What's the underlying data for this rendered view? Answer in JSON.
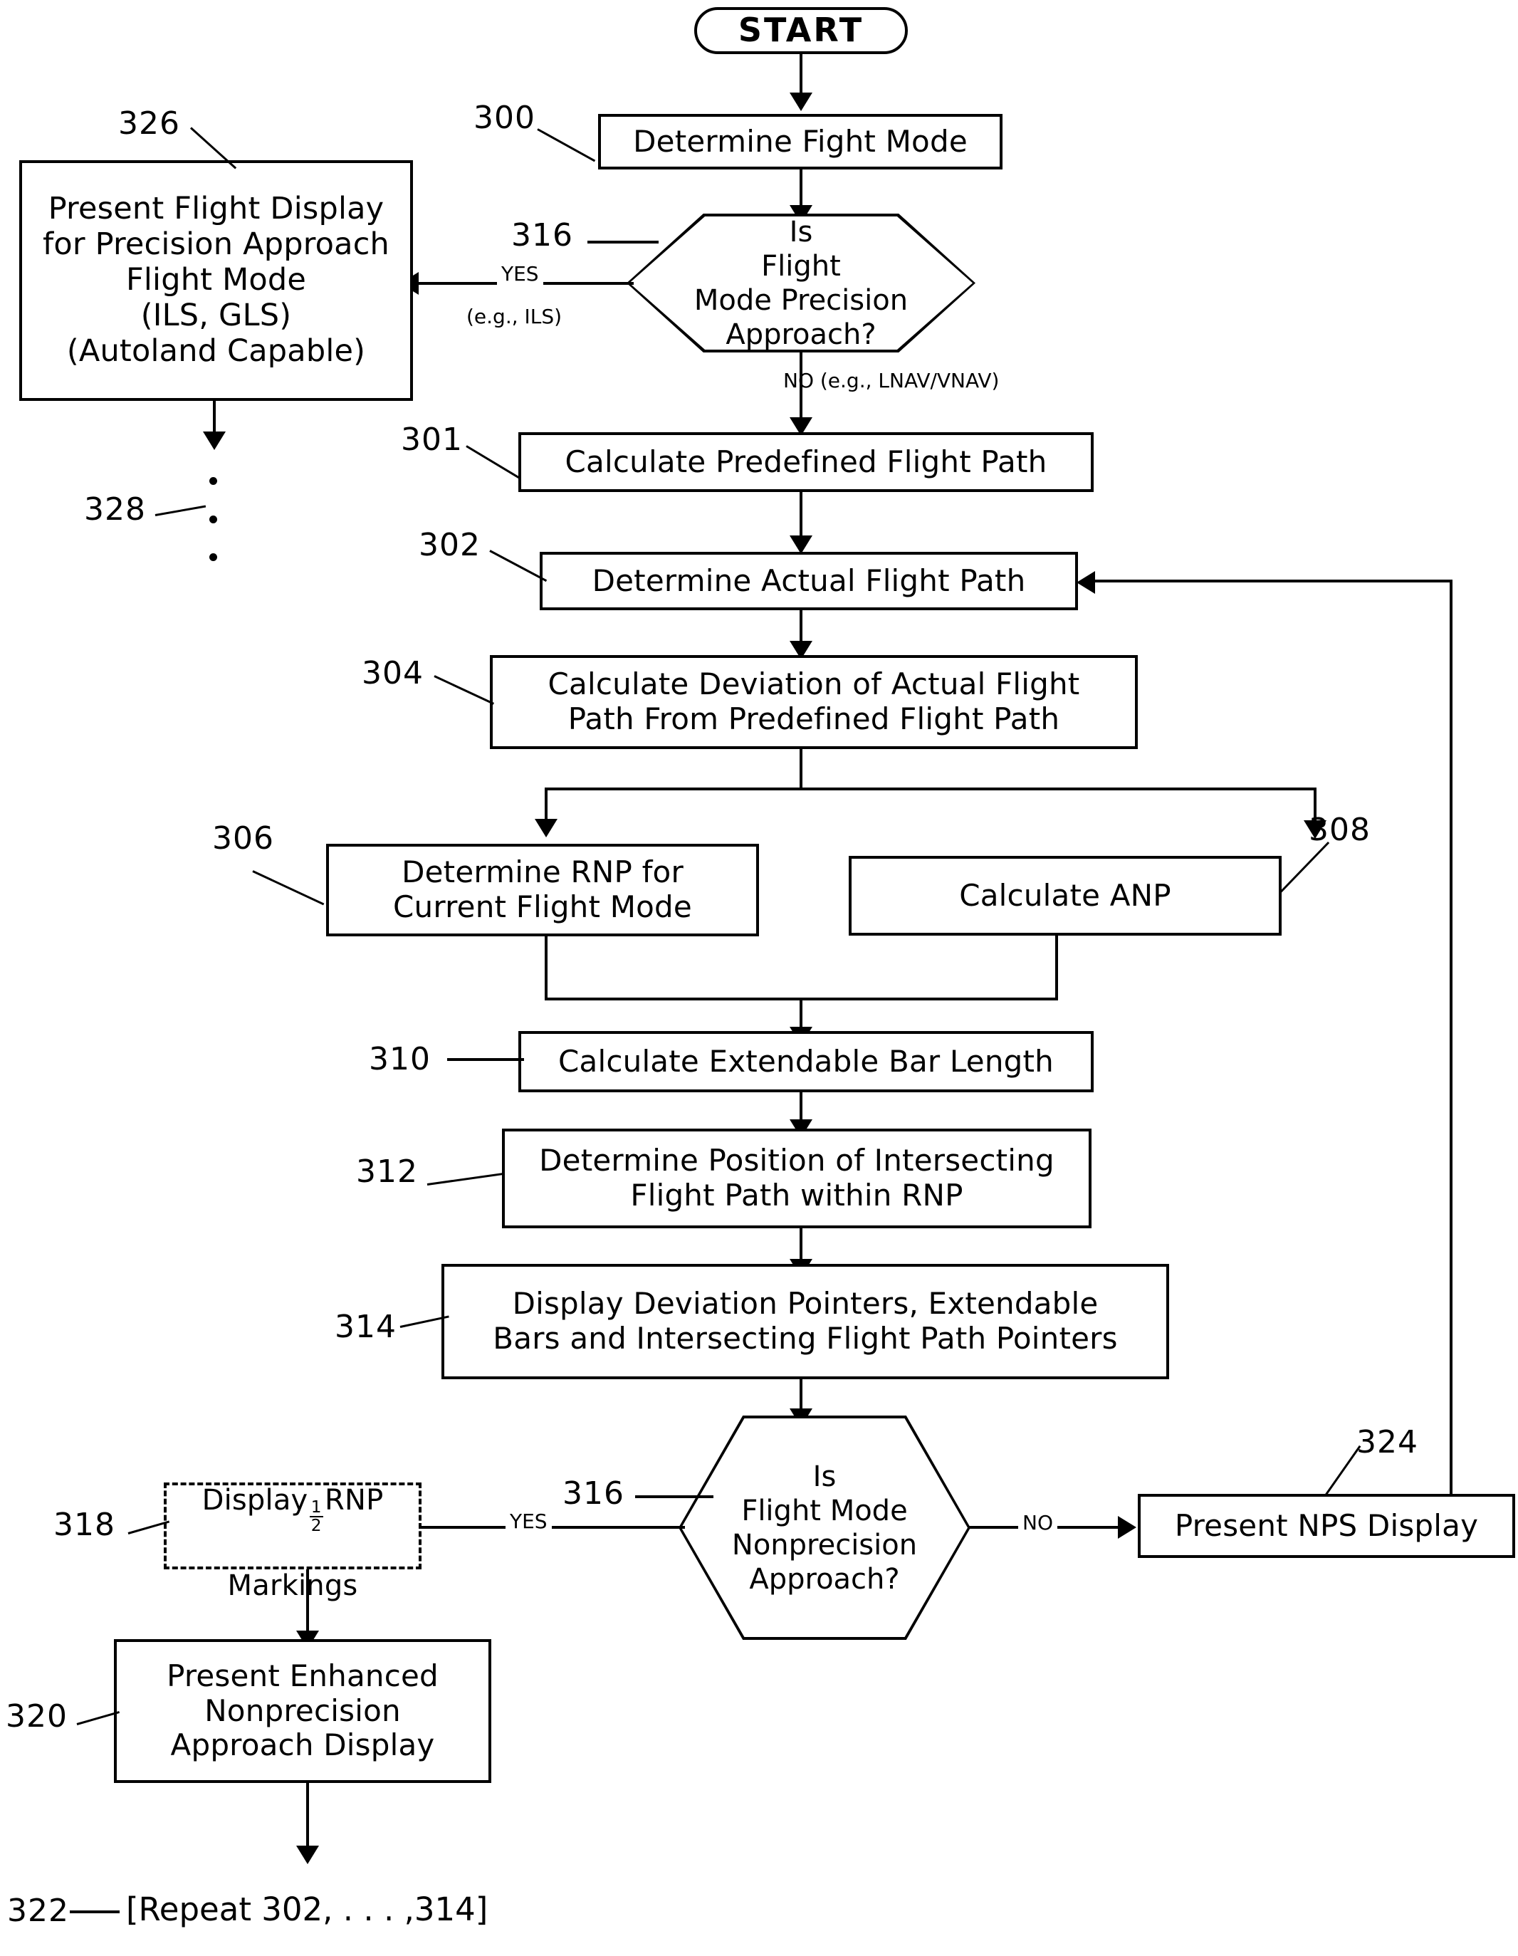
{
  "figure": {
    "type": "patent-flowchart",
    "terminal": {
      "label": "START"
    },
    "nodes": [
      {
        "ref": "300",
        "label": "Determine Fight Mode",
        "shape": "process"
      },
      {
        "ref": "316",
        "label": "Is\nFlight\nMode Precision\nApproach?",
        "shape": "decision"
      },
      {
        "ref": "326",
        "label": "Present Flight Display\nfor Precision Approach\nFlight Mode\n(ILS, GLS)\n(Autoland Capable)",
        "shape": "process"
      },
      {
        "ref": "301",
        "label": "Calculate Predefined Flight Path",
        "shape": "process"
      },
      {
        "ref": "302",
        "label": "Determine Actual Flight Path",
        "shape": "process"
      },
      {
        "ref": "304",
        "label": "Calculate Deviation of Actual Flight\nPath From Predefined Flight Path",
        "shape": "process"
      },
      {
        "ref": "306",
        "label": "Determine RNP for\nCurrent Flight Mode",
        "shape": "process"
      },
      {
        "ref": "308",
        "label": "Calculate ANP",
        "shape": "process"
      },
      {
        "ref": "310",
        "label": "Calculate Extendable Bar Length",
        "shape": "process"
      },
      {
        "ref": "312",
        "label": "Determine Position of Intersecting\nFlight Path within RNP",
        "shape": "process"
      },
      {
        "ref": "314",
        "label": "Display Deviation Pointers, Extendable\nBars and Intersecting Flight Path Pointers",
        "shape": "process"
      },
      {
        "ref": "316b",
        "label": "Is\nFlight Mode\nNonprecision\nApproach?",
        "shape": "decision"
      },
      {
        "ref": "318",
        "label_prefix": "Display ",
        "label_suffix": " RNP\nMarkings",
        "fraction": "1/2",
        "shape": "process-dashed"
      },
      {
        "ref": "324",
        "label": "Present NPS Display",
        "shape": "process"
      },
      {
        "ref": "320",
        "label": "Present Enhanced\nNonprecision\nApproach Display",
        "shape": "process"
      },
      {
        "ref": "322",
        "label": "[Repeat 302, . . . ,314]",
        "shape": "text"
      },
      {
        "ref": "328",
        "label": "",
        "shape": "continuation-dots"
      }
    ],
    "refs": {
      "n300": "300",
      "n301": "301",
      "n302": "302",
      "n304": "304",
      "n306": "306",
      "n308": "308",
      "n310": "310",
      "n312": "312",
      "n314": "314",
      "n316_top": "316",
      "n316_bottom": "316",
      "n318": "318",
      "n320": "320",
      "n322": "322",
      "n324": "324",
      "n326": "326",
      "n328": "328"
    },
    "edge_labels": {
      "yes_top": "YES",
      "yes_top_note": "(e.g., ILS)",
      "no_top": "NO (e.g., LNAV/VNAV)",
      "yes_bottom": "YES",
      "no_bottom": "NO"
    },
    "box_text": {
      "start": "START",
      "determine_fight_mode": "Determine Fight Mode",
      "decision_precision": "Is\nFlight\nMode Precision\nApproach?",
      "precision_display": "Present Flight Display\nfor Precision Approach\nFlight Mode\n(ILS, GLS)\n(Autoland Capable)",
      "calc_predefined": "Calculate Predefined Flight Path",
      "determine_actual": "Determine Actual Flight Path",
      "calc_deviation": "Calculate Deviation of Actual Flight\nPath From Predefined Flight Path",
      "determine_rnp": "Determine RNP for\nCurrent Flight Mode",
      "calculate_anp": "Calculate ANP",
      "calc_bar_length": "Calculate Extendable Bar Length",
      "determine_position": "Determine Position of Intersecting\nFlight Path within RNP",
      "display_pointers": "Display Deviation Pointers, Extendable\nBars and Intersecting Flight Path Pointers",
      "decision_nonprecision": "Is\nFlight Mode\nNonprecision\nApproach?",
      "display_half_rnp_pre": "Display",
      "display_half_rnp_post": "RNP",
      "display_half_rnp_line2": "Markings",
      "present_nps": "Present NPS Display",
      "present_enhanced": "Present Enhanced\nNonprecision\nApproach Display",
      "repeat_note": "[Repeat 302, . . . ,314]"
    },
    "colors": {
      "ink": "#000000",
      "paper": "#ffffff"
    }
  }
}
